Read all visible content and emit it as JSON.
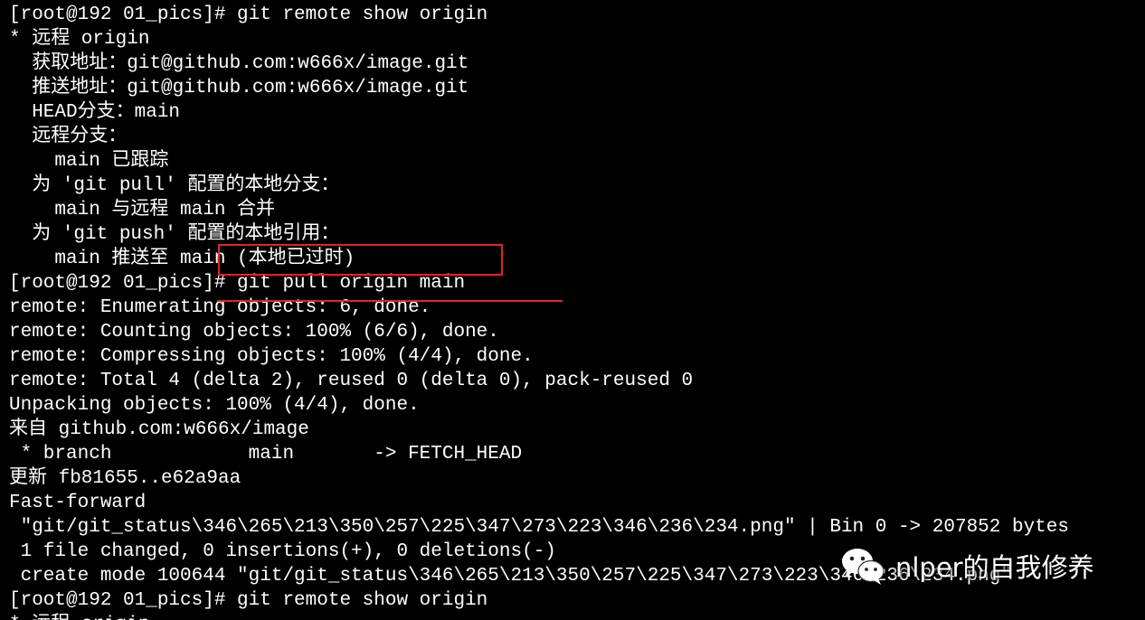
{
  "terminal": {
    "lines": [
      "[root@192 01_pics]# git remote show origin",
      "* 远程 origin",
      "  获取地址：git@github.com:w666x/image.git",
      "  推送地址：git@github.com:w666x/image.git",
      "  HEAD分支：main",
      "  远程分支：",
      "    main 已跟踪",
      "  为 'git pull' 配置的本地分支：",
      "    main 与远程 main 合并",
      "  为 'git push' 配置的本地引用：",
      "    main 推送至 main (本地已过时)",
      "[root@192 01_pics]# git pull origin main",
      "remote: Enumerating objects: 6, done.",
      "remote: Counting objects: 100% (6/6), done.",
      "remote: Compressing objects: 100% (4/4), done.",
      "remote: Total 4 (delta 2), reused 0 (delta 0), pack-reused 0",
      "Unpacking objects: 100% (4/4), done.",
      "来自 github.com:w666x/image",
      " * branch            main       -> FETCH_HEAD",
      "更新 fb81655..e62a9aa",
      "Fast-forward",
      " \"git/git_status\\346\\265\\213\\350\\257\\225\\347\\273\\223\\346\\236\\234.png\" | Bin 0 -> 207852 bytes",
      " 1 file changed, 0 insertions(+), 0 deletions(-)",
      " create mode 100644 \"git/git_status\\346\\265\\213\\350\\257\\225\\347\\273\\223\\346\\236\\234.png\"",
      "[root@192 01_pics]# git remote show origin",
      "* 远程 origin"
    ]
  },
  "colors": {
    "background": "#000000",
    "text": "#ffffff",
    "annotation": "#e02424"
  },
  "watermark": {
    "icon": "wechat-icon",
    "text": "nlper的自我修养"
  }
}
